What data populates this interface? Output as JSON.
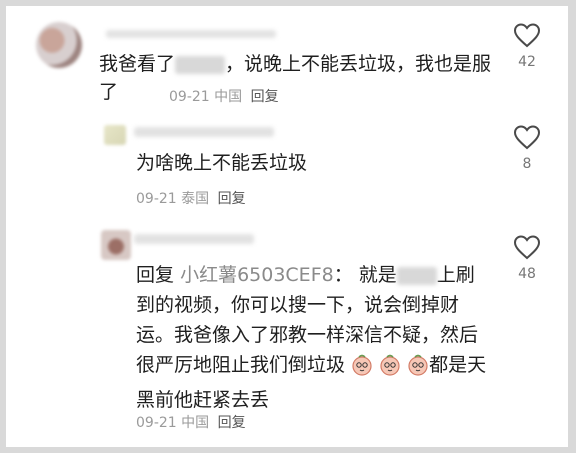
{
  "comments": [
    {
      "text_before": "我爸看了",
      "text_after": "，说晚上不能丢垃圾，我也是服了",
      "date": "09-21",
      "region": "中国",
      "reply_label": "回复",
      "likes": "42"
    },
    {
      "text": "为啥晚上不能丢垃圾",
      "date": "09-21",
      "region": "泰国",
      "reply_label": "回复",
      "likes": "8"
    },
    {
      "reply_label_prefix": "回复",
      "reply_to_user": "小红薯6503CEF8",
      "colon": "：",
      "text_before": "就是",
      "text_mid": "上刷到的视频，你可以搜一下，说会倒掉财运。我爸像入了邪教一样深信不疑，然后很严厉地阻止我们倒垃圾",
      "text_after": "都是天黑前他赶紧去丢",
      "date": "09-21",
      "region": "中国",
      "reply_label": "回复",
      "likes": "48"
    }
  ]
}
